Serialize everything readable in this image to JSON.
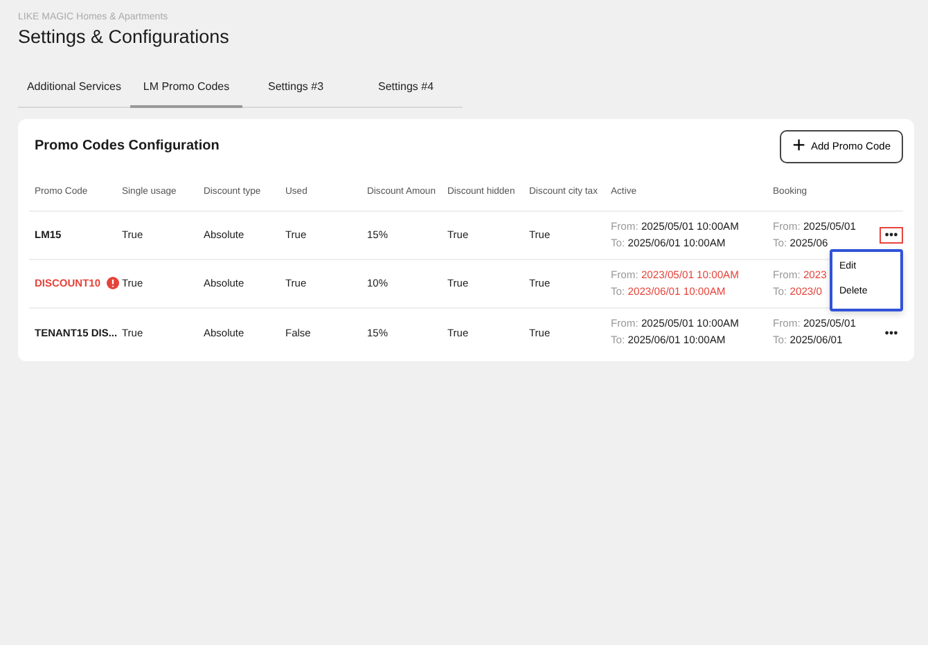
{
  "breadcrumb": "LIKE MAGIC Homes & Apartments",
  "title": "Settings & Configurations",
  "tabs": [
    {
      "label": "Additional Services",
      "selected": false
    },
    {
      "label": "LM Promo Codes",
      "selected": true
    },
    {
      "label": "Settings #3",
      "selected": false
    },
    {
      "label": "Settings #4",
      "selected": false
    }
  ],
  "card": {
    "title": "Promo Codes Configuration",
    "add_button": {
      "icon": "+",
      "label": "Add Promo Code"
    }
  },
  "columns": [
    "Promo Code",
    "Single usage",
    "Discount type",
    "Used",
    "Discount Amoun",
    "Discount hidden",
    "Discount city tax",
    "Active",
    "Booking"
  ],
  "rows": [
    {
      "code": "LM15",
      "expired": false,
      "cells": [
        "True",
        "Absolute",
        "True",
        "15%",
        "True",
        "True"
      ],
      "active": {
        "from_label": "From:",
        "from": "2025/05/01 10:00AM",
        "to_label": "To:",
        "to": "2025/06/01 10:00AM"
      },
      "booking": {
        "from_label": "From:",
        "from": "2025/05/01",
        "to_label": "To:",
        "to": "2025/06"
      },
      "menu_open": true
    },
    {
      "code": "DISCOUNT10",
      "expired": true,
      "cells": [
        "True",
        "Absolute",
        "True",
        "10%",
        "True",
        "True"
      ],
      "active": {
        "from_label": "From:",
        "from": "2023/05/01 10:00AM",
        "to_label": "To:",
        "to": "2023/06/01 10:00AM"
      },
      "booking": {
        "from_label": "From:",
        "from": "2023",
        "to_label": "To:",
        "to": "2023/0"
      },
      "menu_open": false
    },
    {
      "code": "TENANT15 DIS...",
      "expired": false,
      "cells": [
        "True",
        "Absolute",
        "False",
        "15%",
        "True",
        "True"
      ],
      "active": {
        "from_label": "From:",
        "from": "2025/05/01 10:00AM",
        "to_label": "To:",
        "to": "2025/06/01 10:00AM"
      },
      "booking": {
        "from_label": "From:",
        "from": "2025/05/01",
        "to_label": "To:",
        "to": "2025/06/01"
      },
      "menu_open": false
    }
  ],
  "menu": {
    "items": [
      "Edit",
      "Delete"
    ]
  }
}
